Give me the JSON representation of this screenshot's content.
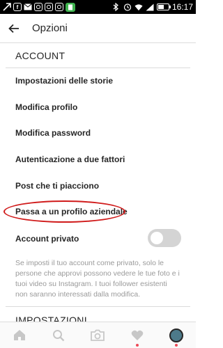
{
  "status_bar": {
    "time": "16:17",
    "box_icon_letter": "f",
    "battery_level": 0.55
  },
  "header": {
    "title": "Opzioni"
  },
  "account": {
    "section_title": "ACCOUNT",
    "items": [
      {
        "label": "Impostazioni delle storie"
      },
      {
        "label": "Modifica profilo"
      },
      {
        "label": "Modifica password"
      },
      {
        "label": "Autenticazione a due fattori"
      },
      {
        "label": "Post che ti piacciono"
      },
      {
        "label": "Passa a un profilo aziendale"
      }
    ],
    "private_account_label": "Account privato",
    "private_account_enabled": false,
    "private_description": "Se imposti il tuo account come privato, solo le persone che approvi possono vedere le tue foto e i tuoi video su Instagram. I tuoi follower esistenti non saranno interessati dalla modifica."
  },
  "next_section_title": "IMPOSTAZIONI",
  "bottom_nav": {
    "items": [
      "home-icon",
      "search-icon",
      "camera-icon",
      "heart-icon",
      "profile-avatar"
    ],
    "highlight_color": "#d01a1a",
    "notification_color": "#ed4956"
  }
}
